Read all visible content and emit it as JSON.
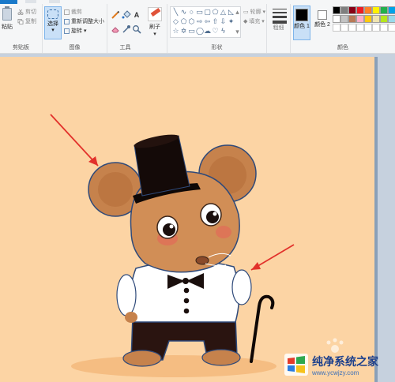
{
  "ribbon": {
    "clipboard": {
      "paste_label": "粘贴",
      "cut_label": "剪切",
      "copy_label": "复制",
      "group_label": "剪贴板"
    },
    "image": {
      "select_label": "选择",
      "crop_label": "裁剪",
      "resize_label": "重新调整大小",
      "rotate_label": "旋转",
      "group_label": "图像"
    },
    "tools": {
      "group_label": "工具",
      "text_tool_glyph": "A"
    },
    "brushes": {
      "label": "刷子"
    },
    "shapes": {
      "outline_label": "轮廓",
      "fill_label": "填充",
      "group_label": "形状"
    },
    "size": {
      "label": "粗细"
    },
    "colors": {
      "color1_label": "颜色 1",
      "color2_label": "颜色 2",
      "group_label": "颜色",
      "color1_value": "#000000",
      "color2_value": "#ffffff",
      "palette_row1": [
        "#000000",
        "#7f7f7f",
        "#880015",
        "#ed1c24",
        "#ff7f27",
        "#fff200",
        "#22b14c",
        "#00a2e8"
      ],
      "palette_row2": [
        "#ffffff",
        "#c3c3c3",
        "#b97a57",
        "#ffaec9",
        "#ffc90e",
        "#efe4b0",
        "#b5e61d",
        "#99d9ea"
      ]
    }
  },
  "canvas": {
    "background": "#fcd4a4"
  },
  "watermark": {
    "title": "纯净系统之家",
    "url": "www.ycwjzy.com"
  }
}
